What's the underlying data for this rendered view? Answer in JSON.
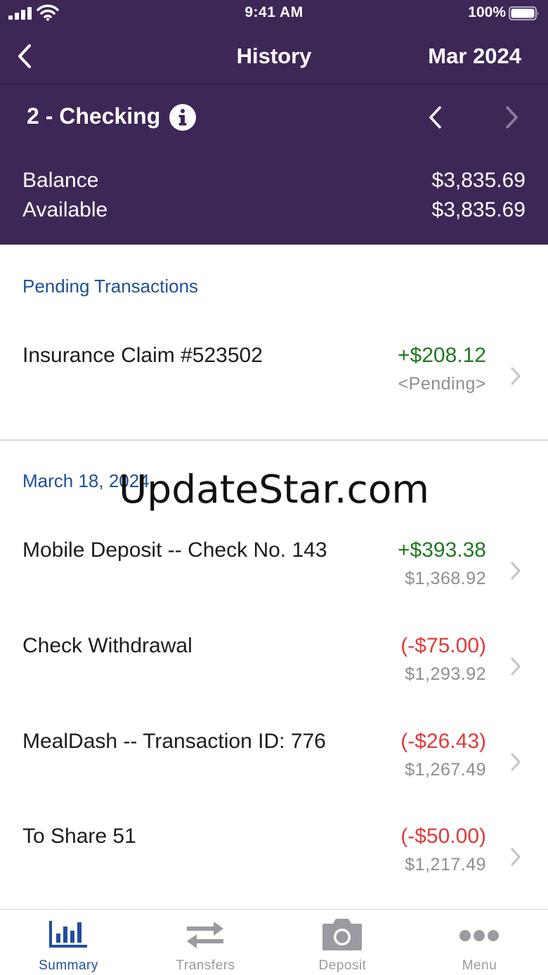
{
  "status_bar": {
    "time": "9:41 AM",
    "battery": "100%"
  },
  "nav": {
    "title": "History",
    "month": "Mar 2024"
  },
  "account": {
    "name": "2 - Checking",
    "balance_label": "Balance",
    "balance_value": "$3,835.69",
    "available_label": "Available",
    "available_value": "$3,835.69"
  },
  "pending": {
    "header": "Pending Transactions",
    "items": [
      {
        "description": "Insurance Claim #523502",
        "amount": "+$208.12",
        "sub": "<Pending>"
      }
    ]
  },
  "dated_group": {
    "header": "March 18, 2024",
    "items": [
      {
        "description": "Mobile Deposit -- Check No. 143",
        "amount": "+$393.38",
        "sub": "$1,368.92"
      },
      {
        "description": "Check Withdrawal",
        "amount": "(-$75.00)",
        "sub": "$1,293.92"
      },
      {
        "description": "MealDash -- Transaction ID: 776",
        "amount": "(-$26.43)",
        "sub": "$1,267.49"
      },
      {
        "description": "To Share 51",
        "amount": "(-$50.00)",
        "sub": "$1,217.49"
      }
    ]
  },
  "watermark": "UpdateStar.com",
  "tabs": [
    {
      "label": "Summary",
      "icon": "bar-chart-icon"
    },
    {
      "label": "Transfers",
      "icon": "transfer-arrows-icon"
    },
    {
      "label": "Deposit",
      "icon": "camera-icon"
    },
    {
      "label": "Menu",
      "icon": "more-dots-icon"
    }
  ],
  "colors": {
    "header_bg": "#3d2756",
    "accent_blue": "#1f4f9a",
    "positive": "#1f7a1f",
    "negative": "#e03a3a",
    "muted": "#8e8e93"
  }
}
